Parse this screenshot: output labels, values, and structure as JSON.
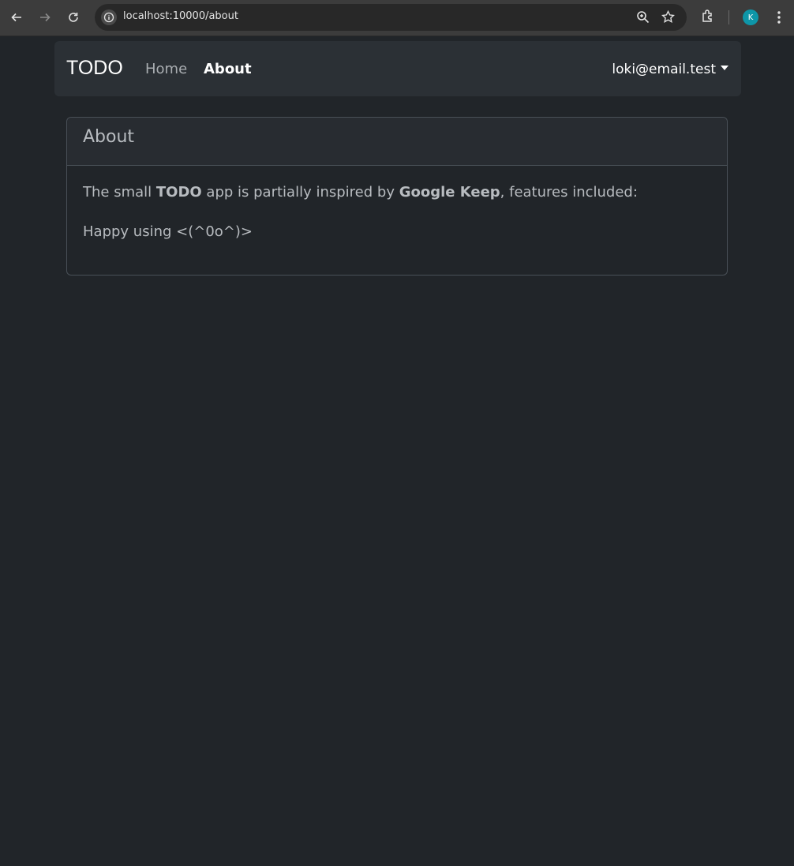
{
  "browser": {
    "url": "localhost:10000/about",
    "profile_initial": "K"
  },
  "navbar": {
    "brand": "TODO",
    "links": [
      {
        "label": "Home",
        "active": false
      },
      {
        "label": "About",
        "active": true
      }
    ],
    "user": "loki@email.test"
  },
  "card": {
    "header": "About",
    "line1_prefix": "The small ",
    "line1_app": "TODO",
    "line1_middle": " app is partially inspired by ",
    "line1_inspiration": "Google Keep",
    "line1_suffix": ", features included:",
    "line2": "Happy using <(^0o^)>"
  },
  "colors": {
    "background": "#212529",
    "navbar": "#2b3035",
    "text": "#b8bcc0"
  }
}
